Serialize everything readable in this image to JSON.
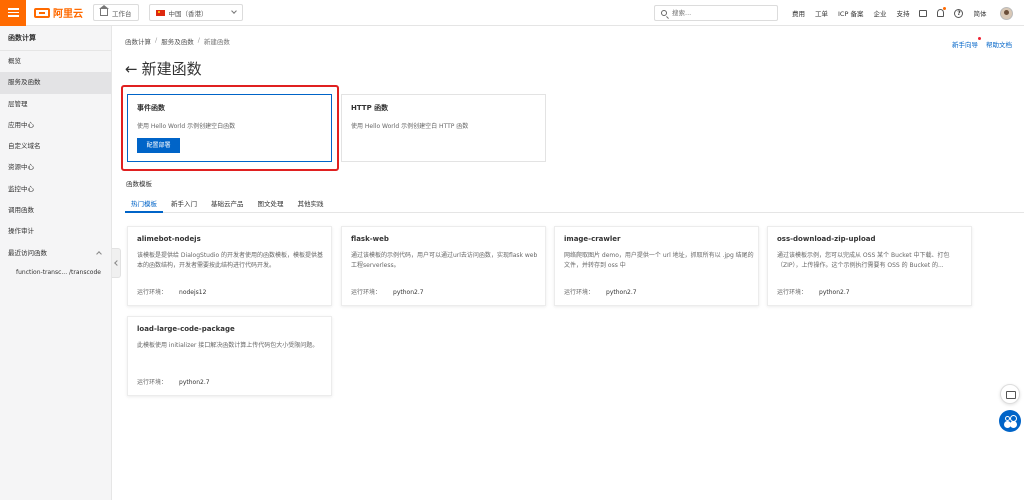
{
  "topbar": {
    "logo": "阿里云",
    "workbench": "工作台",
    "region": "中国（香港）",
    "search_placeholder": "搜索...",
    "links": [
      "费用",
      "工单",
      "ICP 备案",
      "企业",
      "支持"
    ],
    "lang": "简体"
  },
  "sidebar": {
    "title": "函数计算",
    "items": [
      "概览",
      "服务及函数",
      "层管理",
      "应用中心",
      "自定义域名",
      "资源中心",
      "监控中心",
      "调用函数",
      "操作审计",
      "最近访问函数"
    ],
    "recent": "function-transc... /transcode"
  },
  "breadcrumb": [
    "函数计算",
    "服务及函数",
    "新建函数"
  ],
  "right_links": [
    "新手向导",
    "帮助文档"
  ],
  "page_title": "新建函数",
  "function_types": [
    {
      "title": "事件函数",
      "desc": "使用 Hello World 示例创建空白函数",
      "button": "配置部署"
    },
    {
      "title": "HTTP 函数",
      "desc": "使用 Hello World 示例创建空白 HTTP 函数"
    }
  ],
  "templates_label": "函数模板",
  "tabs": [
    "热门模板",
    "新手入门",
    "基础云产品",
    "图文处理",
    "其他实践"
  ],
  "env_label": "运行环境：",
  "templates": [
    {
      "name": "alimebot-nodejs",
      "desc": "该模板是提供给 DialogStudio 的开发者使用的函数模板，模板提供基本的函数结构，开发者需要按此结构进行代码开发。",
      "runtime": "nodejs12"
    },
    {
      "name": "flask-web",
      "desc": "通过该模板的示例代码，用户可以通过url去访问函数，实现flask web工程serverless。",
      "runtime": "python2.7"
    },
    {
      "name": "image-crawler",
      "desc": "网络爬取图片 demo，用户提供一个 url 地址，抓取所有以 .jpg 结尾的文件，并转存到 oss 中",
      "runtime": "python2.7"
    },
    {
      "name": "oss-download-zip-upload",
      "desc": "通过该模板示例，您可以完成从 OSS 某个 Bucket 中下载、打包（ZIP），上传操作。这个示例执行需要有 OSS 的 Bucket 的...",
      "runtime": "python2.7"
    },
    {
      "name": "load-large-code-package",
      "desc": "此模板使用 initializer 接口解决函数计算上传代码包大小受限问题。",
      "runtime": "python2.7"
    }
  ],
  "colors": {
    "brand": "#ff6a00",
    "primary": "#0064c8",
    "highlight": "#e02020"
  }
}
